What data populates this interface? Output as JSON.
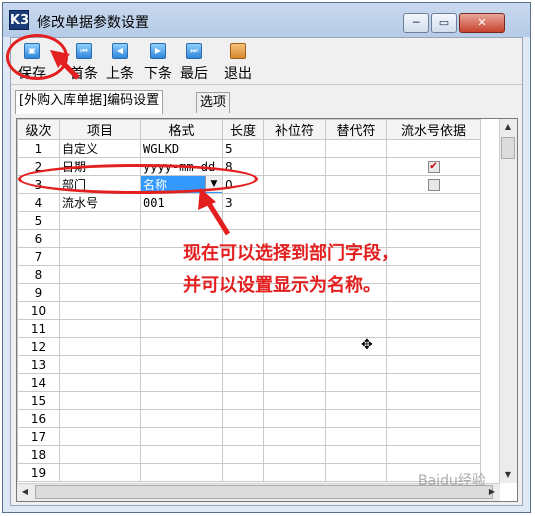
{
  "window": {
    "title": "修改单据参数设置",
    "icon_text": "K3",
    "min_glyph": "─",
    "max_glyph": "▭",
    "close_glyph": "✕"
  },
  "toolbar": {
    "save": "保存",
    "first": "首条",
    "prev": "上条",
    "next": "下条",
    "last": "最后",
    "exit": "退出"
  },
  "tabs": {
    "t1": "[外购入库单据]编码设置",
    "t2": "选项"
  },
  "grid": {
    "headers": [
      "级次",
      "项目",
      "格式",
      "长度",
      "补位符",
      "替代符",
      "流水号依据"
    ],
    "rows": [
      {
        "n": "1",
        "item": "自定义",
        "fmt": "WGLKD",
        "len": "5"
      },
      {
        "n": "2",
        "item": "日期",
        "fmt": "yyyy-mm-dd",
        "len": "8"
      },
      {
        "n": "3",
        "item": "部门",
        "fmt": "名称",
        "len": "0"
      },
      {
        "n": "4",
        "item": "流水号",
        "fmt": "001",
        "len": "3"
      },
      {
        "n": "5"
      },
      {
        "n": "6"
      },
      {
        "n": "7"
      },
      {
        "n": "8"
      },
      {
        "n": "9"
      },
      {
        "n": "10"
      },
      {
        "n": "11"
      },
      {
        "n": "12"
      },
      {
        "n": "13"
      },
      {
        "n": "14"
      },
      {
        "n": "15"
      },
      {
        "n": "16"
      },
      {
        "n": "17"
      },
      {
        "n": "18"
      },
      {
        "n": "19"
      }
    ]
  },
  "annotation": {
    "line1": "现在可以选择到部门字段，",
    "line2": "并可以设置显示为名称。"
  },
  "watermark": "Baidu经验",
  "colors": {
    "annotation_red": "#e41f1f",
    "selection_blue": "#3399ff"
  }
}
